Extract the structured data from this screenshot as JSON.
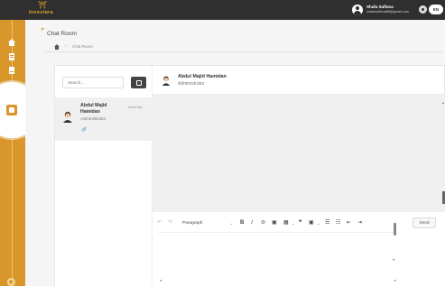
{
  "app": {
    "logo_text": "Investara",
    "logo_mark": "⛩"
  },
  "user": {
    "name": "Shafa Saffana",
    "email": "shafasaffana88@gmail.com",
    "language": "EN"
  },
  "page": {
    "title": "Chat Room",
    "breadcrumb_sep": "›",
    "breadcrumb_current": "Chat Room"
  },
  "search": {
    "placeholder": "Search..."
  },
  "contacts": [
    {
      "name": "Abdul Majid Hamidan",
      "role": "Administrator",
      "time": "Yesterday",
      "attachment_icon": "🔗"
    }
  ],
  "chat": {
    "name": "Abdul Majid Hamidan",
    "role": "Administrator"
  },
  "editor": {
    "undo": "↶",
    "redo": "↷",
    "paragraph_label": "Paragraph",
    "caret": "⌄",
    "bold": "B",
    "italic": "I",
    "link": "⊘",
    "image": "▣",
    "table": "▦",
    "table_caret": "⌄",
    "quote": "❝",
    "media": "▣",
    "media_caret": "⌄",
    "bulleted_list": "☰",
    "numbered_list": "☷",
    "outdent": "⇤",
    "indent": "⇥",
    "scroll_left": "◂",
    "scroll_right": "▸",
    "scroll_down": "▾",
    "scroll_up": "▴"
  },
  "send_label": "Send",
  "colors": {
    "accent": "#d9962a",
    "topbar": "#2f2f2f"
  }
}
